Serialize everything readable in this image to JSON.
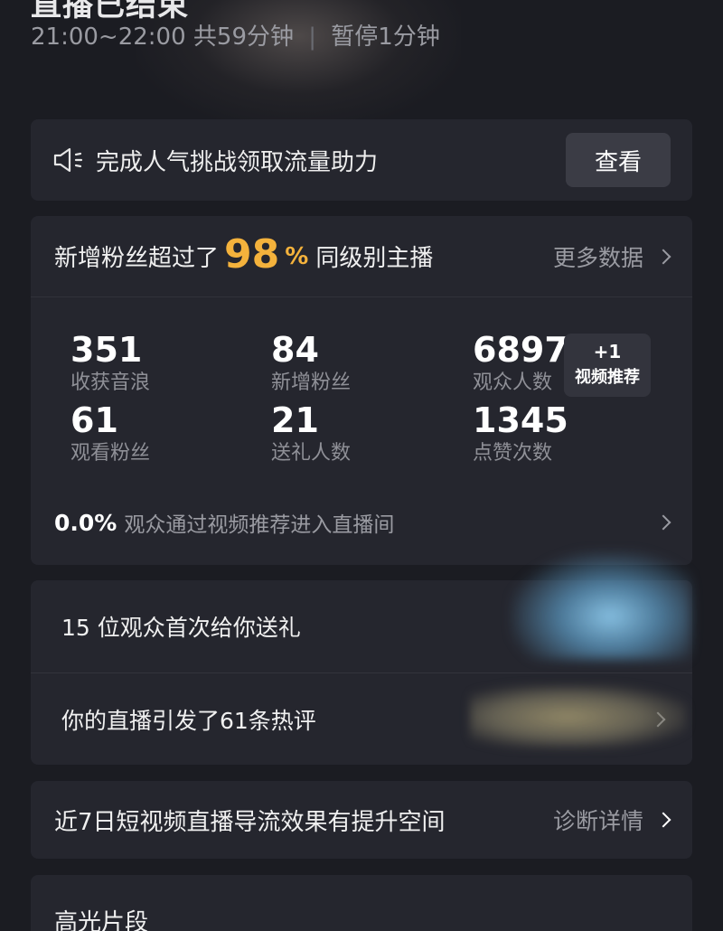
{
  "header": {
    "title": "直播已结束",
    "time_range": "21:00~22:00",
    "duration": "共59分钟",
    "pause": "暂停1分钟"
  },
  "notice": {
    "text": "完成人气挑战领取流量助力",
    "button": "查看"
  },
  "stats": {
    "head_pre": "新增粉丝超过了",
    "percent": "98",
    "percent_sign": "%",
    "head_post": "同级别主播",
    "more": "更多数据",
    "metrics": [
      {
        "value": "351",
        "label": "收获音浪"
      },
      {
        "value": "84",
        "label": "新增粉丝"
      },
      {
        "value": "6897",
        "label": "观众人数"
      },
      {
        "value": "61",
        "label": "观看粉丝"
      },
      {
        "value": "21",
        "label": "送礼人数"
      },
      {
        "value": "1345",
        "label": "点赞次数"
      }
    ],
    "badge": {
      "line1": "+1",
      "line2": "视频推荐"
    },
    "ratio_value": "0.0%",
    "ratio_desc": "观众通过视频推荐进入直播间"
  },
  "list": {
    "row1": "15 位观众首次给你送礼",
    "row2": "你的直播引发了61条热评"
  },
  "diagnosis": {
    "text": "近7日短视频直播导流效果有提升空间",
    "more": "诊断详情"
  },
  "highlight": {
    "title": "高光片段"
  },
  "colors": {
    "background": "#1b1c22",
    "card": "#25262e",
    "accent": "#f4b23c",
    "secondary_text": "#9a9ba2"
  }
}
